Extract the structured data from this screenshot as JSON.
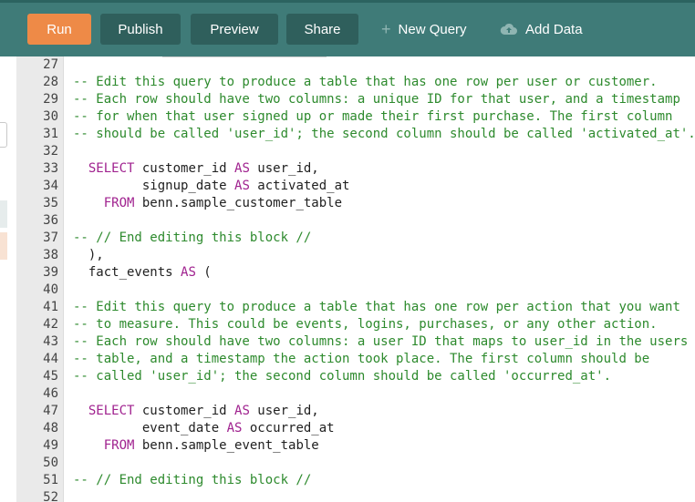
{
  "toolbar": {
    "run_label": "Run",
    "publish_label": "Publish",
    "preview_label": "Preview",
    "share_label": "Share",
    "new_query_label": "New Query",
    "add_data_label": "Add Data",
    "icons": {
      "new_query": "plus-icon",
      "add_data": "cloud-upload-icon"
    },
    "colors": {
      "toolbar_bg": "#3f7b78",
      "run_bg": "#ee8a47",
      "button_bg": "#2f5f5c"
    }
  },
  "editor": {
    "lines": [
      {
        "num": "27",
        "segments": []
      },
      {
        "num": "28",
        "segments": [
          {
            "t": "-- Edit this query to produce a table that has one row per user or customer.",
            "c": "cmt"
          }
        ]
      },
      {
        "num": "29",
        "segments": [
          {
            "t": "-- Each row should have two columns: a unique ID for that user, and a timestamp",
            "c": "cmt"
          }
        ]
      },
      {
        "num": "30",
        "segments": [
          {
            "t": "-- for when that user signed up or made their first purchase. The first column",
            "c": "cmt"
          }
        ]
      },
      {
        "num": "31",
        "segments": [
          {
            "t": "-- should be called 'user_id'; the second column should be called 'activated_at'.",
            "c": "cmt"
          }
        ]
      },
      {
        "num": "32",
        "segments": []
      },
      {
        "num": "33",
        "segments": [
          {
            "t": "  "
          },
          {
            "t": "SELECT",
            "c": "kw"
          },
          {
            "t": " customer_id "
          },
          {
            "t": "AS",
            "c": "kw"
          },
          {
            "t": " user_id,"
          }
        ]
      },
      {
        "num": "34",
        "segments": [
          {
            "t": "         signup_date "
          },
          {
            "t": "AS",
            "c": "kw"
          },
          {
            "t": " activated_at"
          }
        ]
      },
      {
        "num": "35",
        "segments": [
          {
            "t": "    "
          },
          {
            "t": "FROM",
            "c": "kw"
          },
          {
            "t": " benn.sample_customer_table"
          }
        ]
      },
      {
        "num": "36",
        "segments": []
      },
      {
        "num": "37",
        "segments": [
          {
            "t": "-- // End editing this block //",
            "c": "cmt"
          }
        ]
      },
      {
        "num": "38",
        "segments": [
          {
            "t": "  ),"
          }
        ]
      },
      {
        "num": "39",
        "segments": [
          {
            "t": "  fact_events "
          },
          {
            "t": "AS",
            "c": "kw"
          },
          {
            "t": " ("
          }
        ]
      },
      {
        "num": "40",
        "segments": []
      },
      {
        "num": "41",
        "segments": [
          {
            "t": "-- Edit this query to produce a table that has one row per action that you want",
            "c": "cmt"
          }
        ]
      },
      {
        "num": "42",
        "segments": [
          {
            "t": "-- to measure. This could be events, logins, purchases, or any other action.",
            "c": "cmt"
          }
        ]
      },
      {
        "num": "43",
        "segments": [
          {
            "t": "-- Each row should have two columns: a user ID that maps to user_id in the users",
            "c": "cmt"
          }
        ]
      },
      {
        "num": "44",
        "segments": [
          {
            "t": "-- table, and a timestamp the action took place. The first column should be",
            "c": "cmt"
          }
        ]
      },
      {
        "num": "45",
        "segments": [
          {
            "t": "-- called 'user_id'; the second column should be called 'occurred_at'.",
            "c": "cmt"
          }
        ]
      },
      {
        "num": "46",
        "segments": []
      },
      {
        "num": "47",
        "segments": [
          {
            "t": "  "
          },
          {
            "t": "SELECT",
            "c": "kw"
          },
          {
            "t": " customer_id "
          },
          {
            "t": "AS",
            "c": "kw"
          },
          {
            "t": " user_id,"
          }
        ]
      },
      {
        "num": "48",
        "segments": [
          {
            "t": "         event_date "
          },
          {
            "t": "AS",
            "c": "kw"
          },
          {
            "t": " occurred_at"
          }
        ]
      },
      {
        "num": "49",
        "segments": [
          {
            "t": "    "
          },
          {
            "t": "FROM",
            "c": "kw"
          },
          {
            "t": " benn.sample_event_table"
          }
        ]
      },
      {
        "num": "50",
        "segments": []
      },
      {
        "num": "51",
        "segments": [
          {
            "t": "-- // End editing this block //",
            "c": "cmt"
          }
        ]
      },
      {
        "num": "52",
        "segments": []
      }
    ],
    "colors": {
      "comment": "#2d8a2d",
      "keyword": "#a0228f",
      "gutter_bg": "#eaeaea"
    }
  }
}
